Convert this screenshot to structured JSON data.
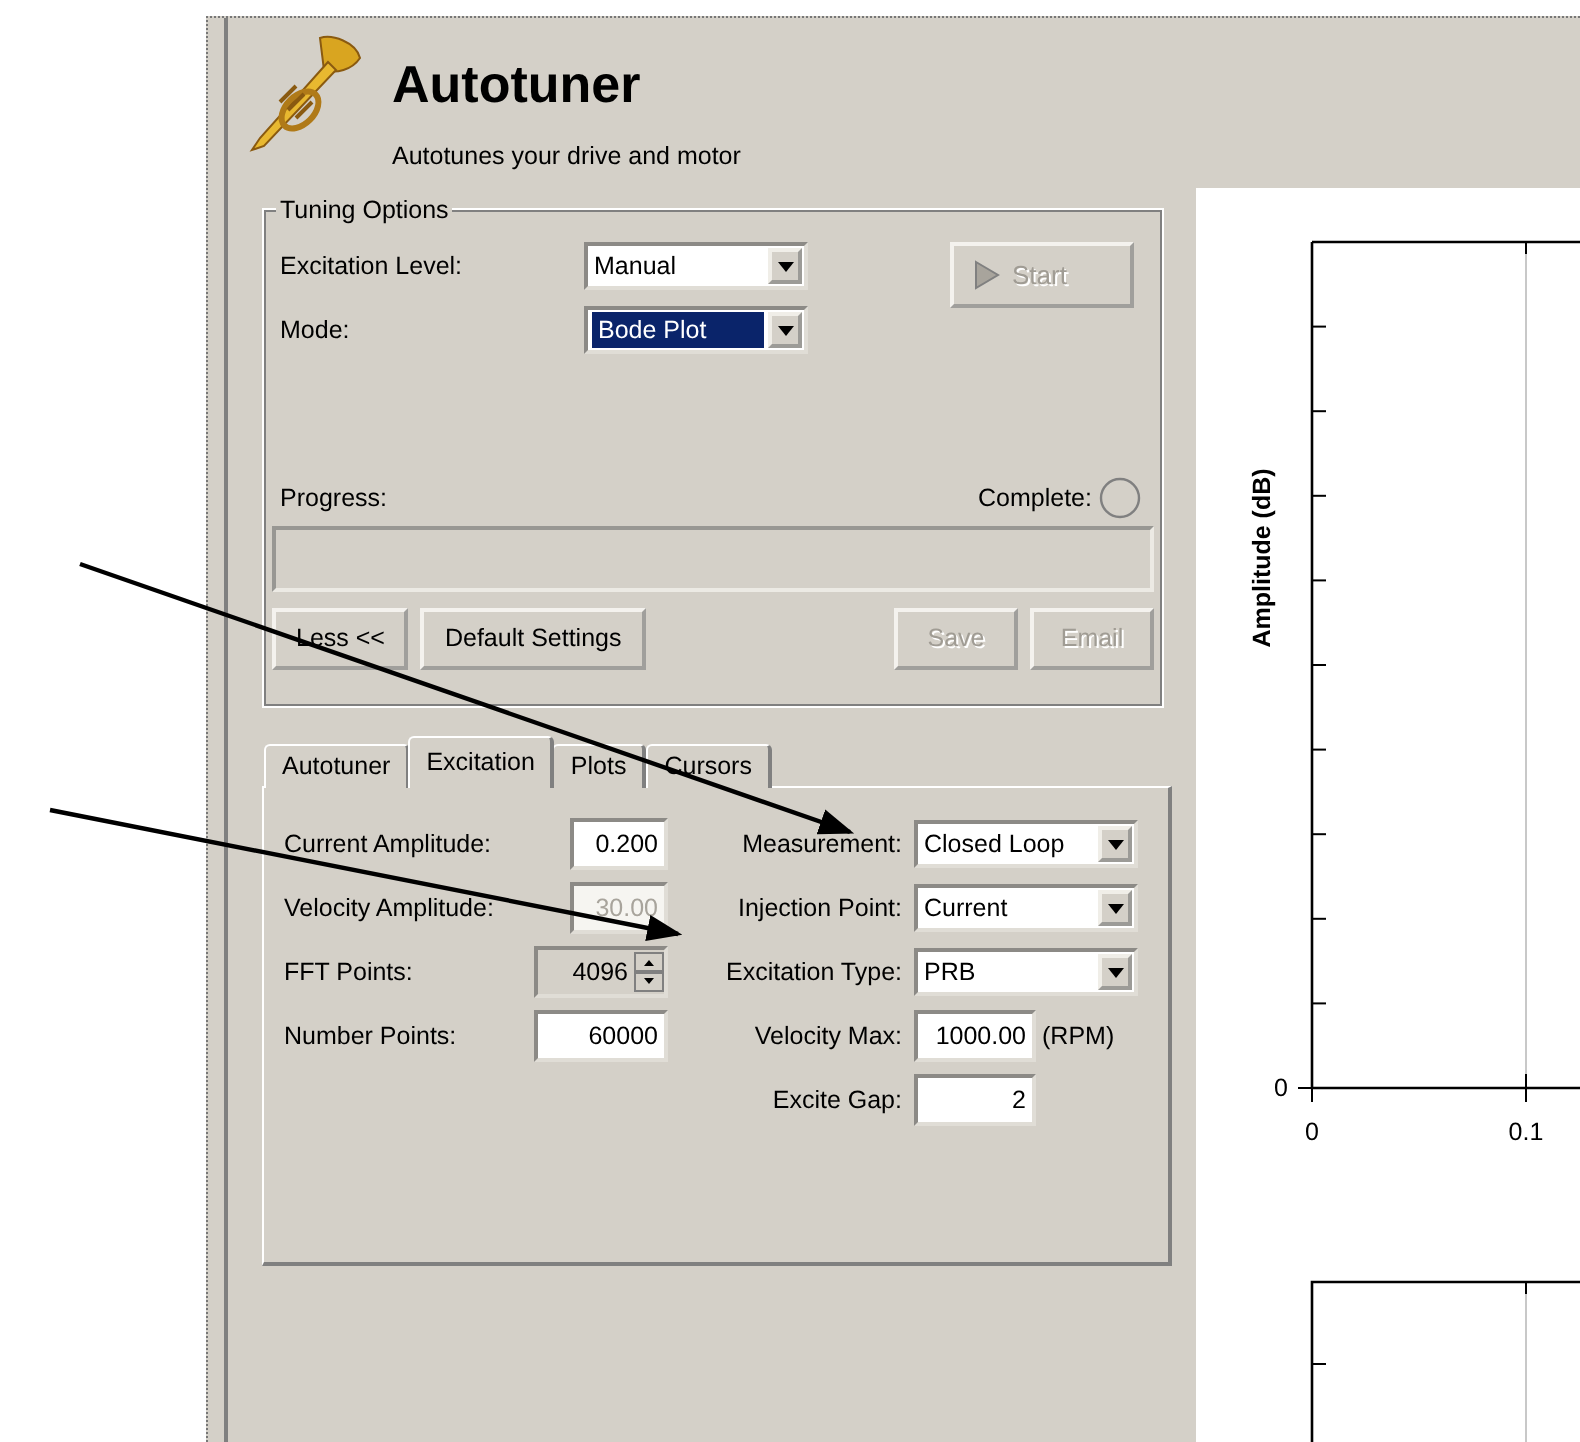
{
  "window": {
    "title": "Autotuner",
    "subtitle": "Autotunes your drive and motor"
  },
  "tuning_options": {
    "title": "Tuning Options",
    "fields": [
      {
        "label": "Excitation Level:",
        "value": "Manual",
        "focused": false
      },
      {
        "label": "Mode:",
        "value": "Bode Plot",
        "focused": true
      }
    ],
    "start_button": {
      "label": "Start",
      "disabled": true
    },
    "progress": {
      "label": "Progress:",
      "level": 0
    },
    "complete": {
      "label": "Complete:"
    },
    "buttons_left": [
      {
        "label": "Less <<",
        "disabled": false
      },
      {
        "label": "Default Settings",
        "disabled": false
      }
    ],
    "buttons_right": [
      {
        "label": "Save",
        "disabled": true
      },
      {
        "label": "Email",
        "disabled": true
      }
    ]
  },
  "tabs": [
    {
      "label": "Autotuner",
      "selected": false
    },
    {
      "label": "Excitation",
      "selected": true
    },
    {
      "label": "Plots",
      "selected": false
    },
    {
      "label": "Cursors",
      "selected": false
    }
  ],
  "excitation": {
    "left": [
      {
        "kind": "input",
        "label": "Current Amplitude:",
        "value": "0.200",
        "disabled": false
      },
      {
        "kind": "input",
        "label": "Velocity Amplitude:",
        "value": "30.00",
        "disabled": true
      },
      {
        "kind": "spinner",
        "label": "FFT Points:",
        "value": "4096",
        "disabled": false
      },
      {
        "kind": "input",
        "label": "Number Points:",
        "value": "60000",
        "disabled": false
      }
    ],
    "right": [
      {
        "kind": "select",
        "label": "Measurement:",
        "value": "Closed Loop"
      },
      {
        "kind": "select",
        "label": "Injection Point:",
        "value": "Current"
      },
      {
        "kind": "select",
        "label": "Excitation Type:",
        "value": "PRB"
      },
      {
        "kind": "input",
        "label": "Velocity Max:",
        "value": "1000.00",
        "unit": "(RPM)"
      },
      {
        "kind": "input",
        "label": "Excite Gap:",
        "value": "2"
      }
    ]
  },
  "plot": {
    "y_label": "Amplitude (dB)",
    "y_tick": "0",
    "x_ticks": [
      "0",
      "0.1"
    ]
  }
}
